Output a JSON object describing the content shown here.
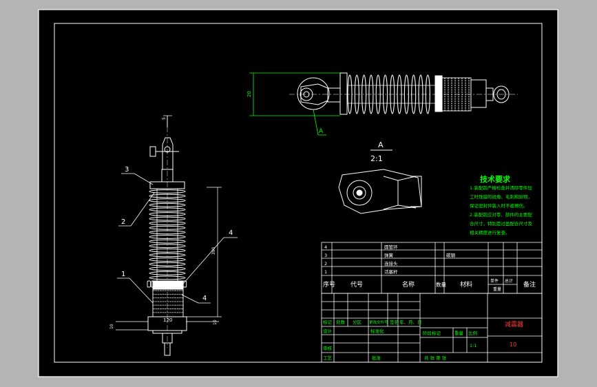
{
  "view": {
    "section_letter": "A",
    "section_title_letter": "A",
    "section_scale": "2:1"
  },
  "dims": {
    "left_height": "20",
    "total_length": "390",
    "top_small": "5",
    "bottom_small": "10",
    "top_offset": "10",
    "base_width": "120"
  },
  "balloons": [
    "3",
    "2",
    "1",
    "4",
    "4"
  ],
  "tech": {
    "title": "技术要求",
    "lines": [
      "1.装配前严格检查并清除零件加",
      "工时残留的锐角、毛刺和异物，",
      "保证密封件装入时不被擦伤。",
      "2.装配前应对零、部件的主要配",
      "合尺寸，特别是过盈配合尺寸及",
      "相关精度进行复查。"
    ]
  },
  "bom": {
    "rows": [
      {
        "no": "4",
        "name": "圆管环",
        "mat": ""
      },
      {
        "no": "3",
        "name": "弹簧",
        "mat": "碳钢"
      },
      {
        "no": "2",
        "name": "连接头",
        "mat": ""
      },
      {
        "no": "1",
        "name": "活塞杆",
        "mat": ""
      }
    ],
    "header": {
      "no": "序号",
      "code": "代号",
      "name": "名称",
      "qty": "数量",
      "mat": "材料",
      "unit_l1": "单件",
      "unit_l2": "重量",
      "total_l1": "总计",
      "total_l2": "",
      "remark": "备注"
    }
  },
  "title_block": {
    "title": "减震器",
    "part_no": "10",
    "labels": {
      "mark": "标记",
      "count": "处数",
      "zone": "分区",
      "change_doc": "更改文件号",
      "sign": "签名",
      "date": "年、月、日",
      "design": "设计",
      "standard": "标准化",
      "stage": "阶段标记",
      "weight": "重量",
      "scale": "比例",
      "scale_val": "1:1",
      "check": "审核",
      "process": "工艺",
      "approve": "批准",
      "sheets": "共 张 第 张"
    }
  },
  "colors": {
    "line": "#ffffff",
    "accent": "#00ff00",
    "title_red": "#ff3b3b",
    "bg": "#000000"
  }
}
